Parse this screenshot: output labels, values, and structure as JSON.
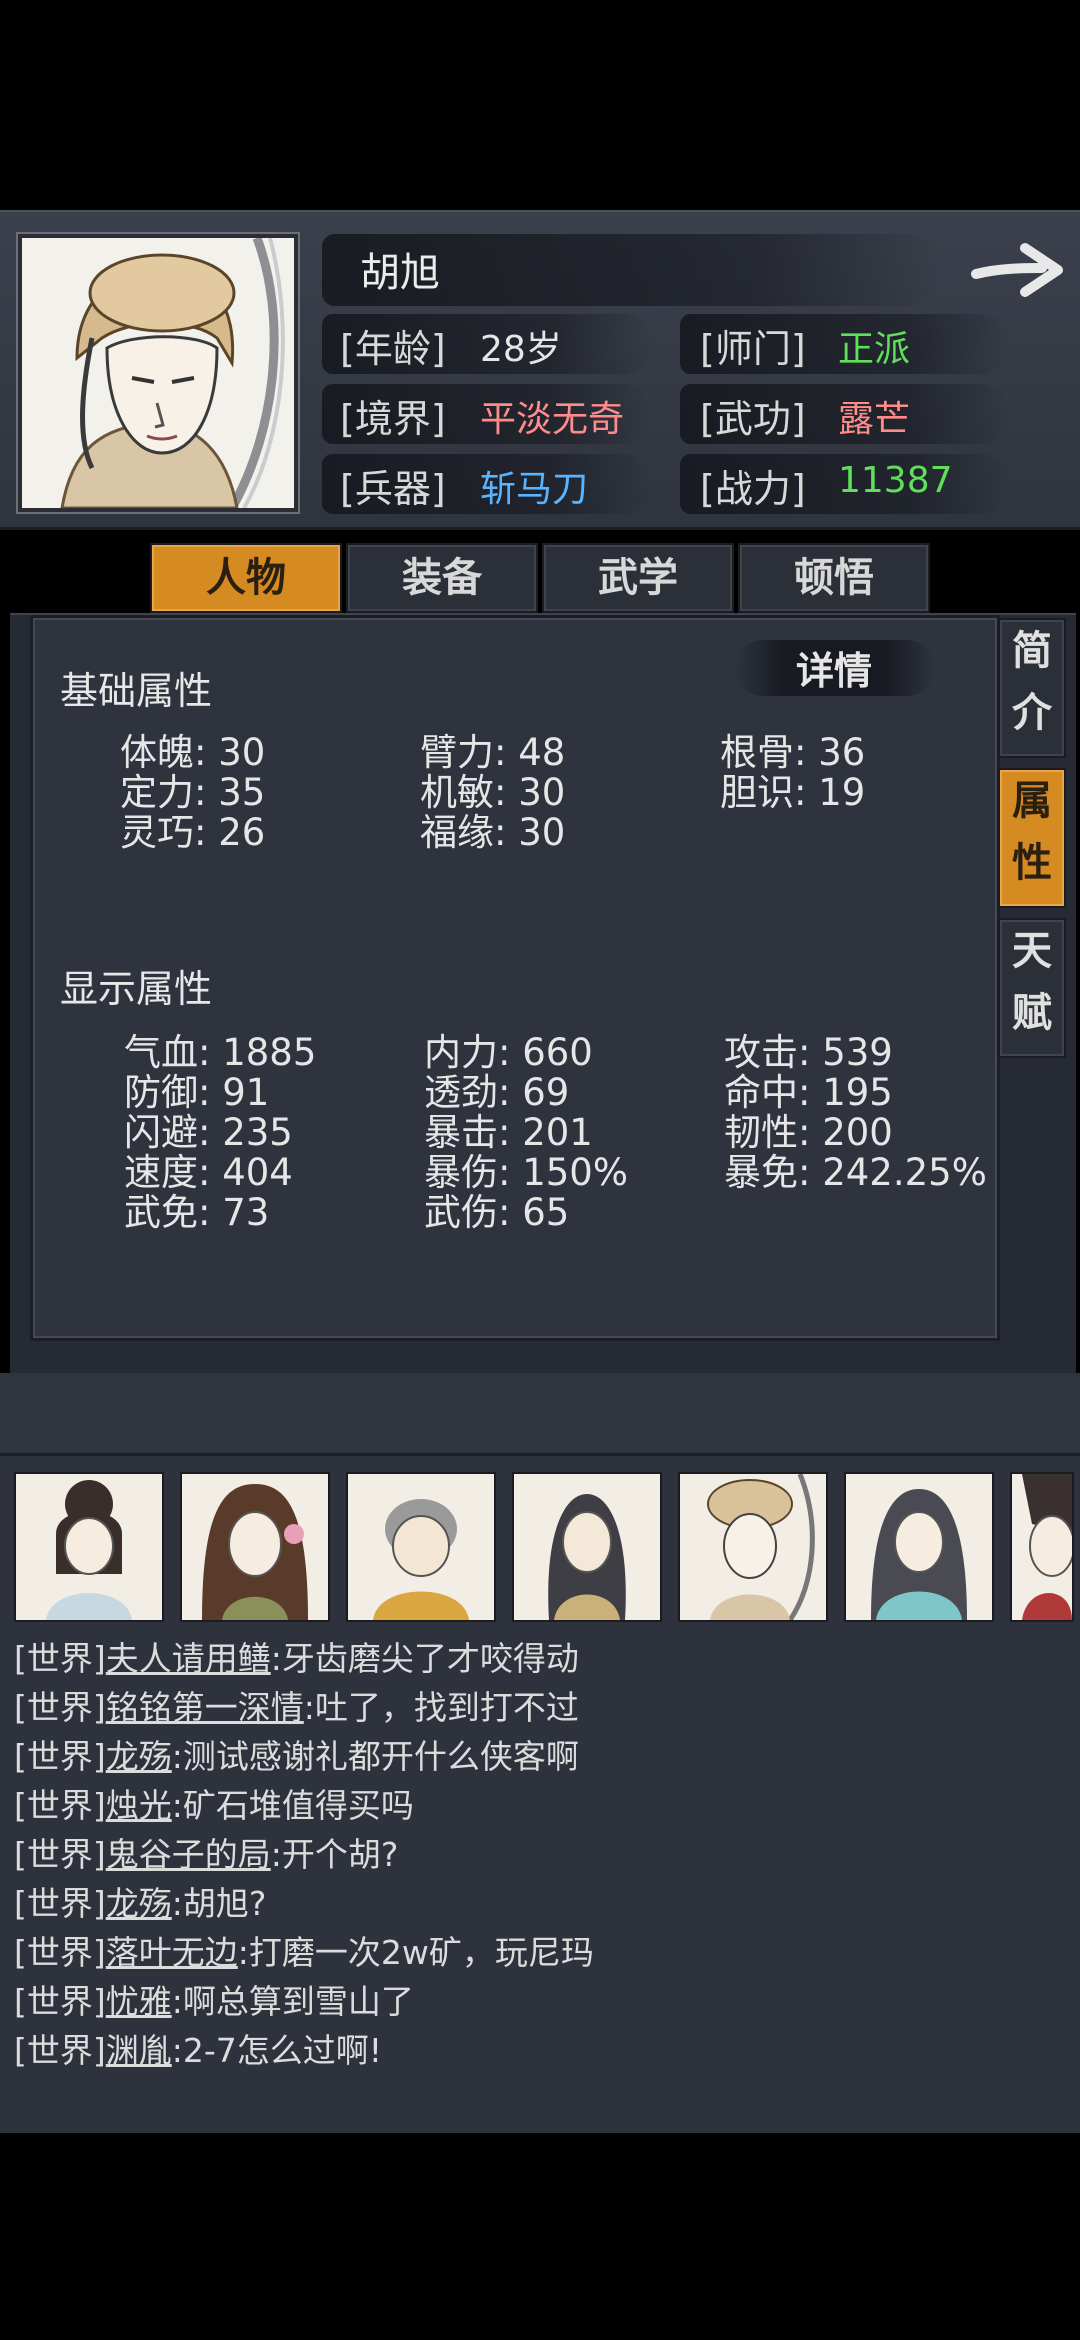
{
  "character": {
    "name": "胡旭",
    "rows": [
      {
        "label": "[年龄]",
        "value": "28岁",
        "color": "#e6e6e6"
      },
      {
        "label": "[师门]",
        "value": "正派",
        "color": "#5fe05a"
      },
      {
        "label": "[境界]",
        "value": "平淡无奇",
        "color": "#ff8b8b"
      },
      {
        "label": "[武功]",
        "value": "露芒",
        "color": "#ff8b8b"
      },
      {
        "label": "[兵器]",
        "value": "斩马刀",
        "color": "#58b4ff"
      },
      {
        "label": "[战力]",
        "value": "11387",
        "color": "#5fe05a"
      }
    ]
  },
  "tabs": [
    "人物",
    "装备",
    "武学",
    "顿悟"
  ],
  "active_tab": 0,
  "detail_label": "详情",
  "base_section": {
    "title": "基础属性",
    "stats": [
      "体魄: 30",
      "臂力: 48",
      "根骨: 36",
      "定力: 35",
      "机敏: 30",
      "胆识: 19",
      "灵巧: 26",
      "福缘: 30"
    ]
  },
  "display_section": {
    "title": "显示属性",
    "stats": [
      "气血: 1885",
      "内力: 660",
      "攻击: 539",
      "防御: 91",
      "透劲: 69",
      "命中: 195",
      "闪避: 235",
      "暴击: 201",
      "韧性: 200",
      "速度: 404",
      "暴伤: 150%",
      "暴免: 242.25%",
      "武免: 73",
      "武伤: 65"
    ]
  },
  "side_tabs": [
    {
      "chars": [
        "简",
        "介"
      ]
    },
    {
      "chars": [
        "属",
        "性"
      ]
    },
    {
      "chars": [
        "天",
        "赋"
      ]
    }
  ],
  "active_side_tab": 1,
  "chat": [
    {
      "channel": "[世界]",
      "who": "夫人请用鳝",
      "msg": ":牙齿磨尖了才咬得动"
    },
    {
      "channel": "[世界]",
      "who": "铭铭第一深情",
      "msg": ":吐了，找到打不过"
    },
    {
      "channel": "[世界]",
      "who": "龙殇",
      "msg": ":测试感谢礼都开什么侠客啊"
    },
    {
      "channel": "[世界]",
      "who": "烛光",
      "msg": ":矿石堆值得买吗"
    },
    {
      "channel": "[世界]",
      "who": "鬼谷子的局",
      "msg": ":开个胡?"
    },
    {
      "channel": "[世界]",
      "who": "龙殇",
      "msg": ":胡旭?"
    },
    {
      "channel": "[世界]",
      "who": "落叶无边",
      "msg": ":打磨一次2w矿，玩尼玛"
    },
    {
      "channel": "[世界]",
      "who": "忧雅",
      "msg": ":啊总算到雪山了"
    },
    {
      "channel": "[世界]",
      "who": "渊胤",
      "msg": ":2-7怎么过啊!"
    }
  ]
}
